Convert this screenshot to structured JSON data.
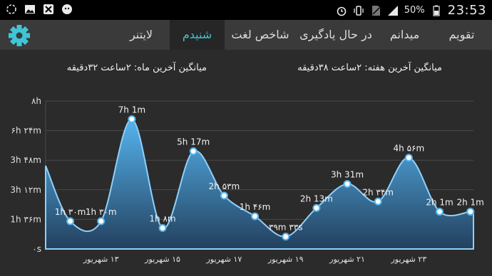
{
  "status_bar": {
    "battery": "50%",
    "time": "23:53",
    "left_icons": [
      "notification-dots-icon",
      "image-icon",
      "no-notify-icon",
      "android-icon"
    ],
    "right_icons": [
      "alarm-icon",
      "vibrate-icon",
      "no-sim-icon",
      "signal-icon",
      "battery-icon"
    ]
  },
  "tabs": [
    {
      "label": "تقویم",
      "active": false
    },
    {
      "label": "میدانم",
      "active": false
    },
    {
      "label": "در حال یادگیری",
      "active": false
    },
    {
      "label": "شاخص لغت",
      "active": false
    },
    {
      "label": "شنیدم",
      "active": true
    },
    {
      "label": "لایتنر",
      "active": false
    }
  ],
  "summary": {
    "week": "میانگین آخرین هفته: ۲ساعت  ۳۸دقیقه",
    "month": "میانگین آخرین ماه: ۲ساعت  ۳۲دقیقه"
  },
  "colors": {
    "accent": "#3ec6d6",
    "bar": "#3a3a3a",
    "area_top": "#55b4ee",
    "area_bottom": "#23405e"
  },
  "chart_data": {
    "type": "area",
    "y_ticks": [
      "۰s",
      "1h ۳۶m",
      "3h ۱۲m",
      "3h ۴۸m",
      "۶h ۲۴m",
      "۸h"
    ],
    "y_tick_minutes": [
      0,
      96,
      192,
      288,
      384,
      480
    ],
    "ylim_minutes": [
      0,
      480
    ],
    "x_labels": [
      "۱۳ شهریور",
      "۱۵ شهریور",
      "۱۷ شهریور",
      "۱۹ شهریور",
      "۲۱ شهریور",
      "۲۳ شهریور"
    ],
    "x_label_days": [
      13,
      15,
      17,
      19,
      21,
      23
    ],
    "x_range_days": [
      11.2,
      25.1
    ],
    "grid": true,
    "points": [
      {
        "day": 12,
        "minutes": 90,
        "label": "1h ۳۰m"
      },
      {
        "day": 13,
        "minutes": 90,
        "label": "1h ۳۰m"
      },
      {
        "day": 14,
        "minutes": 421,
        "label": "7h 1m"
      },
      {
        "day": 15,
        "minutes": 68,
        "label": "1h ۸m"
      },
      {
        "day": 16,
        "minutes": 317,
        "label": "5h 17m"
      },
      {
        "day": 17,
        "minutes": 173,
        "label": "2h ۵۳m"
      },
      {
        "day": 18,
        "minutes": 106,
        "label": "1h ۴۶m"
      },
      {
        "day": 19,
        "minutes": 40,
        "label": "۳۹m ۳۳s"
      },
      {
        "day": 20,
        "minutes": 133,
        "label": "2h 13m"
      },
      {
        "day": 21,
        "minutes": 211,
        "label": "3h 31m"
      },
      {
        "day": 22,
        "minutes": 154,
        "label": "2h ۳۴m"
      },
      {
        "day": 23,
        "minutes": 296,
        "label": "4h ۵۶m"
      },
      {
        "day": 24,
        "minutes": 121,
        "label": "2h 1m"
      },
      {
        "day": 25,
        "minutes": 121,
        "label": "2h 1m"
      }
    ],
    "start_minutes": 270
  }
}
